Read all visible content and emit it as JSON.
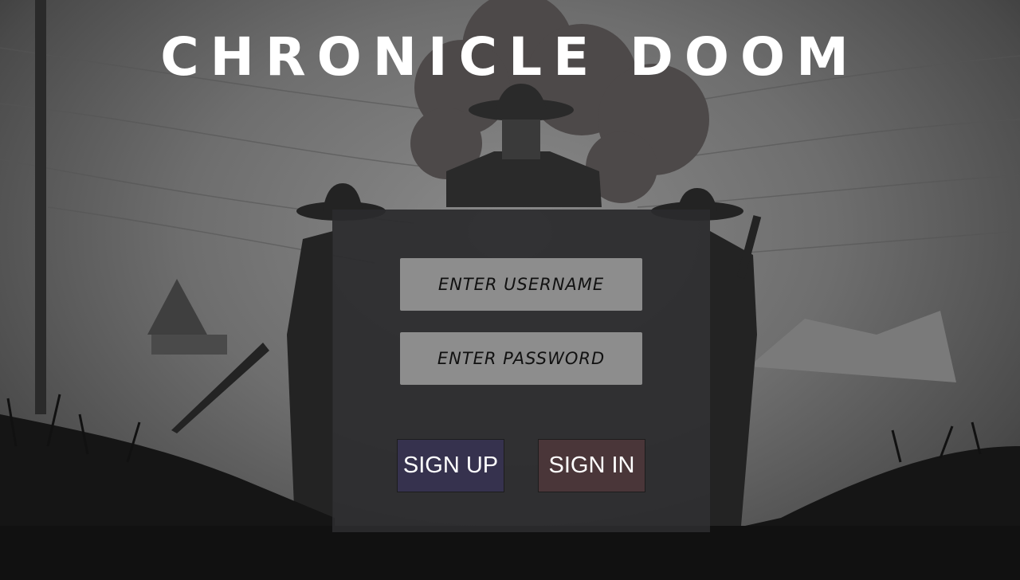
{
  "app": {
    "title": "CHRONICLE DOOM"
  },
  "login": {
    "username_placeholder": "ENTER USERNAME",
    "password_placeholder": "ENTER PASSWORD",
    "signup_label": "SIGN UP",
    "signin_label": "SIGN IN"
  },
  "colors": {
    "panel": "#2b2b2d",
    "input": "#8d8d8d",
    "signup_button": "#36324e",
    "signin_button": "#4a3639",
    "title": "#ffffff"
  }
}
